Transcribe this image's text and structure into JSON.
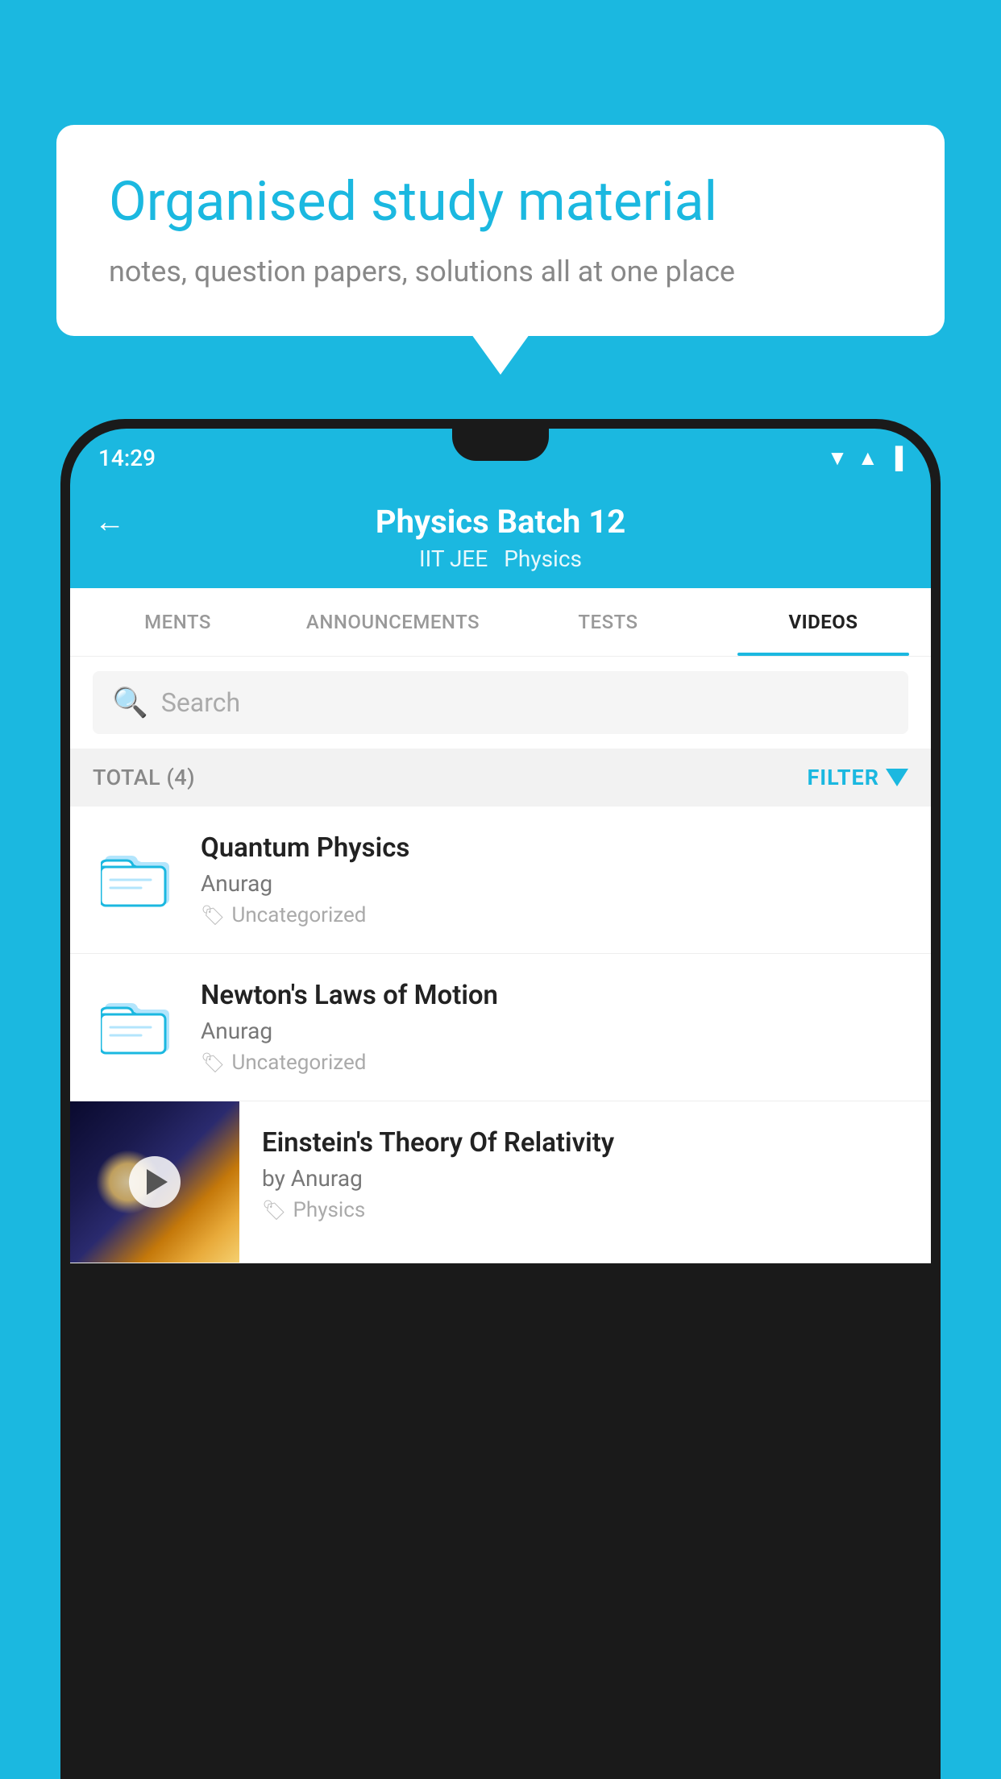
{
  "background_color": "#1BB8E0",
  "speech_bubble": {
    "title": "Organised study material",
    "subtitle": "notes, question papers, solutions all at one place"
  },
  "phone": {
    "status_bar": {
      "time": "14:29",
      "icons": [
        "▼",
        "▲",
        "▐"
      ]
    },
    "header": {
      "back_label": "←",
      "title": "Physics Batch 12",
      "subtitle_parts": [
        "IIT JEE",
        "Physics"
      ]
    },
    "tabs": [
      {
        "label": "MENTS",
        "active": false
      },
      {
        "label": "ANNOUNCEMENTS",
        "active": false
      },
      {
        "label": "TESTS",
        "active": false
      },
      {
        "label": "VIDEOS",
        "active": true
      }
    ],
    "search": {
      "placeholder": "Search"
    },
    "filter_bar": {
      "total_label": "TOTAL (4)",
      "filter_label": "FILTER"
    },
    "videos": [
      {
        "id": "quantum",
        "title": "Quantum Physics",
        "author": "Anurag",
        "tag": "Uncategorized",
        "type": "folder"
      },
      {
        "id": "newton",
        "title": "Newton's Laws of Motion",
        "author": "Anurag",
        "tag": "Uncategorized",
        "type": "folder"
      },
      {
        "id": "einstein",
        "title": "Einstein's Theory Of Relativity",
        "author": "by Anurag",
        "tag": "Physics",
        "type": "video"
      }
    ]
  }
}
